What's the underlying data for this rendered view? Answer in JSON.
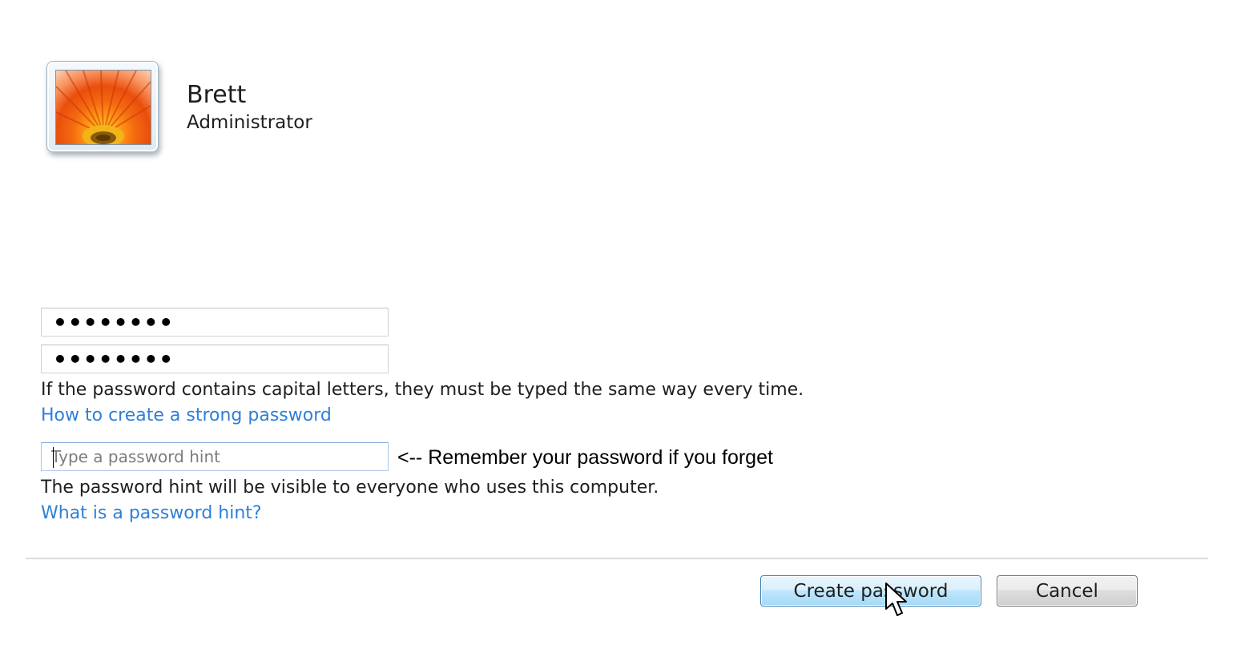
{
  "user": {
    "name": "Brett",
    "role": "Administrator",
    "avatar": "orange-flower-picture"
  },
  "form": {
    "new_password_value": "••••••••",
    "confirm_password_value": "••••••••",
    "capital_letters_note": "If the password contains capital letters, they must be typed the same way every time.",
    "strong_password_link": "How to create a strong password",
    "hint_placeholder": "Type a password hint",
    "hint_annotation": "<-- Remember your password if you forget",
    "hint_visibility_note": "The password hint will be visible to everyone who uses this computer.",
    "hint_help_link": "What is a password hint?"
  },
  "buttons": {
    "create_label": "Create password",
    "cancel_label": "Cancel"
  },
  "colors": {
    "link": "#2f7fd8",
    "primary_button_border": "#3c7fb1"
  },
  "icons": {
    "cursor": "arrow-pointer"
  }
}
